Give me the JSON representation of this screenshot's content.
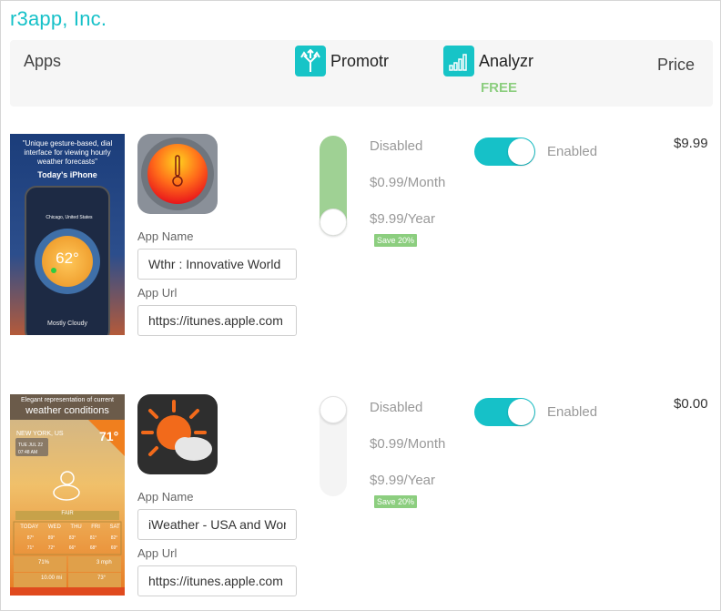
{
  "company": "r3app, Inc.",
  "header": {
    "apps_label": "Apps",
    "price_label": "Price",
    "products": [
      {
        "name": "Promotr",
        "icon": "split-arrows-icon"
      },
      {
        "name": "Analyzr",
        "icon": "bar-chart-icon",
        "badge": "FREE"
      }
    ]
  },
  "colors": {
    "brand": "#16c1c8",
    "green": "#8cce7f",
    "toggle_on": "#16c1c8"
  },
  "apps": [
    {
      "screenshot": {
        "quote": "\"Unique gesture-based, dial interface for viewing hourly weather forecasts\"",
        "caption": "Today's iPhone",
        "city": "Chicago, United States",
        "temp": "62°",
        "footer": "Mostly Cloudy"
      },
      "name_label": "App Name",
      "name_value": "Wthr : Innovative World",
      "url_label": "App Url",
      "url_value": "https://itunes.apple.com",
      "promotr_plan": "disabled",
      "options": {
        "disabled": "Disabled",
        "monthly": "$0.99/Month",
        "yearly": "$9.99/Year",
        "save": "Save 20%"
      },
      "analyzr_state": "Enabled",
      "price": "$9.99"
    },
    {
      "screenshot": {
        "quote": "Elegant representation of current",
        "title": "weather conditions",
        "city": "NEW YORK, US",
        "date": "TUE JUL 22",
        "time": "07:48 AM",
        "temp": "71°",
        "condition": "FAIR",
        "days": [
          "TODAY",
          "WED",
          "THU",
          "FRI",
          "SAT"
        ],
        "highs": [
          "87°",
          "89°",
          "83°",
          "81°",
          "82°"
        ],
        "lows": [
          "71°",
          "72°",
          "66°",
          "68°",
          "69°"
        ],
        "humidity": "71%",
        "wind": "3 mph",
        "visibility": "10.00 mi",
        "feels": "73°"
      },
      "name_label": "App Name",
      "name_value": "iWeather - USA and World",
      "url_label": "App Url",
      "url_value": "https://itunes.apple.com",
      "promotr_plan": "none",
      "options": {
        "disabled": "Disabled",
        "monthly": "$0.99/Month",
        "yearly": "$9.99/Year",
        "save": "Save 20%"
      },
      "analyzr_state": "Enabled",
      "price": "$0.00"
    }
  ]
}
